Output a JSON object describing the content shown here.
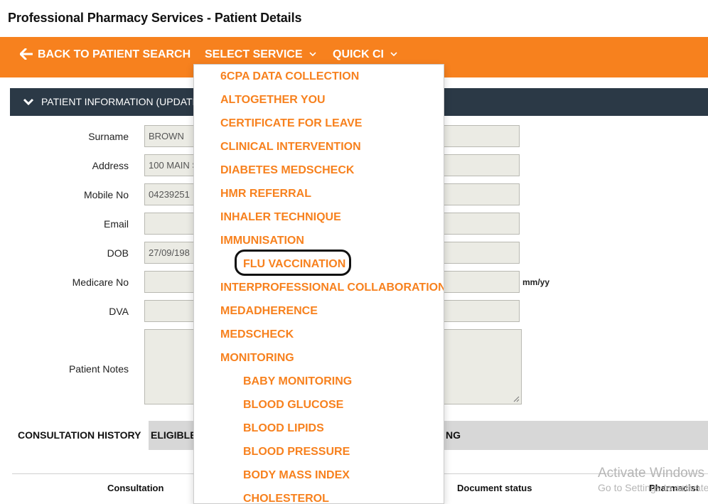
{
  "page": {
    "title": "Professional Pharmacy Services - Patient Details"
  },
  "nav": {
    "back_label": "BACK TO PATIENT SEARCH",
    "select_service_label": "SELECT SERVICE",
    "quick_label": "QUICK CI"
  },
  "panel": {
    "header_label": "PATIENT INFORMATION (UPDATE"
  },
  "form": {
    "surname_label": "Surname",
    "surname_value": "BROWN",
    "address_label": "Address",
    "address_value": "100 MAIN S",
    "mobile_label": "Mobile No",
    "mobile_value": "04239251",
    "email_label": "Email",
    "email_value": "",
    "dob_label": "DOB",
    "dob_value": "27/09/198",
    "medicare_label": "Medicare No",
    "medicare_value": "",
    "medicare_hint": "mm/yy",
    "dva_label": "DVA",
    "dva_value": "",
    "notes_label": "Patient Notes",
    "notes_value": ""
  },
  "tabs": {
    "consultation_history": "CONSULTATION HISTORY",
    "eligible": "ELIGIBLE",
    "third_partial": "NG"
  },
  "table": {
    "col_consultation": "Consultation",
    "col_document_status": "Document status",
    "col_pharmacist": "Pharmacist"
  },
  "watermark": {
    "line1": "Activate Windows",
    "line2": "Go to Settings to activate"
  },
  "dropdown": {
    "items": [
      "6CPA DATA COLLECTION",
      "ALTOGETHER YOU",
      "CERTIFICATE FOR LEAVE",
      "CLINICAL INTERVENTION",
      "DIABETES MEDSCHECK",
      "HMR REFERRAL",
      "INHALER TECHNIQUE",
      "IMMUNISATION",
      "FLU VACCINATION",
      "INTERPROFESSIONAL COLLABORATION",
      "MEDADHERENCE",
      "MEDSCHECK",
      "MONITORING",
      "BABY MONITORING",
      "BLOOD GLUCOSE",
      "BLOOD LIPIDS",
      "BLOOD PRESSURE",
      "BODY MASS INDEX",
      "CHOLESTEROL"
    ]
  },
  "colors": {
    "accent_orange": "#f7811e",
    "panel_header": "#2b3946",
    "input_bg": "#ebebe4",
    "tabs_bg": "#d7d7d7"
  }
}
